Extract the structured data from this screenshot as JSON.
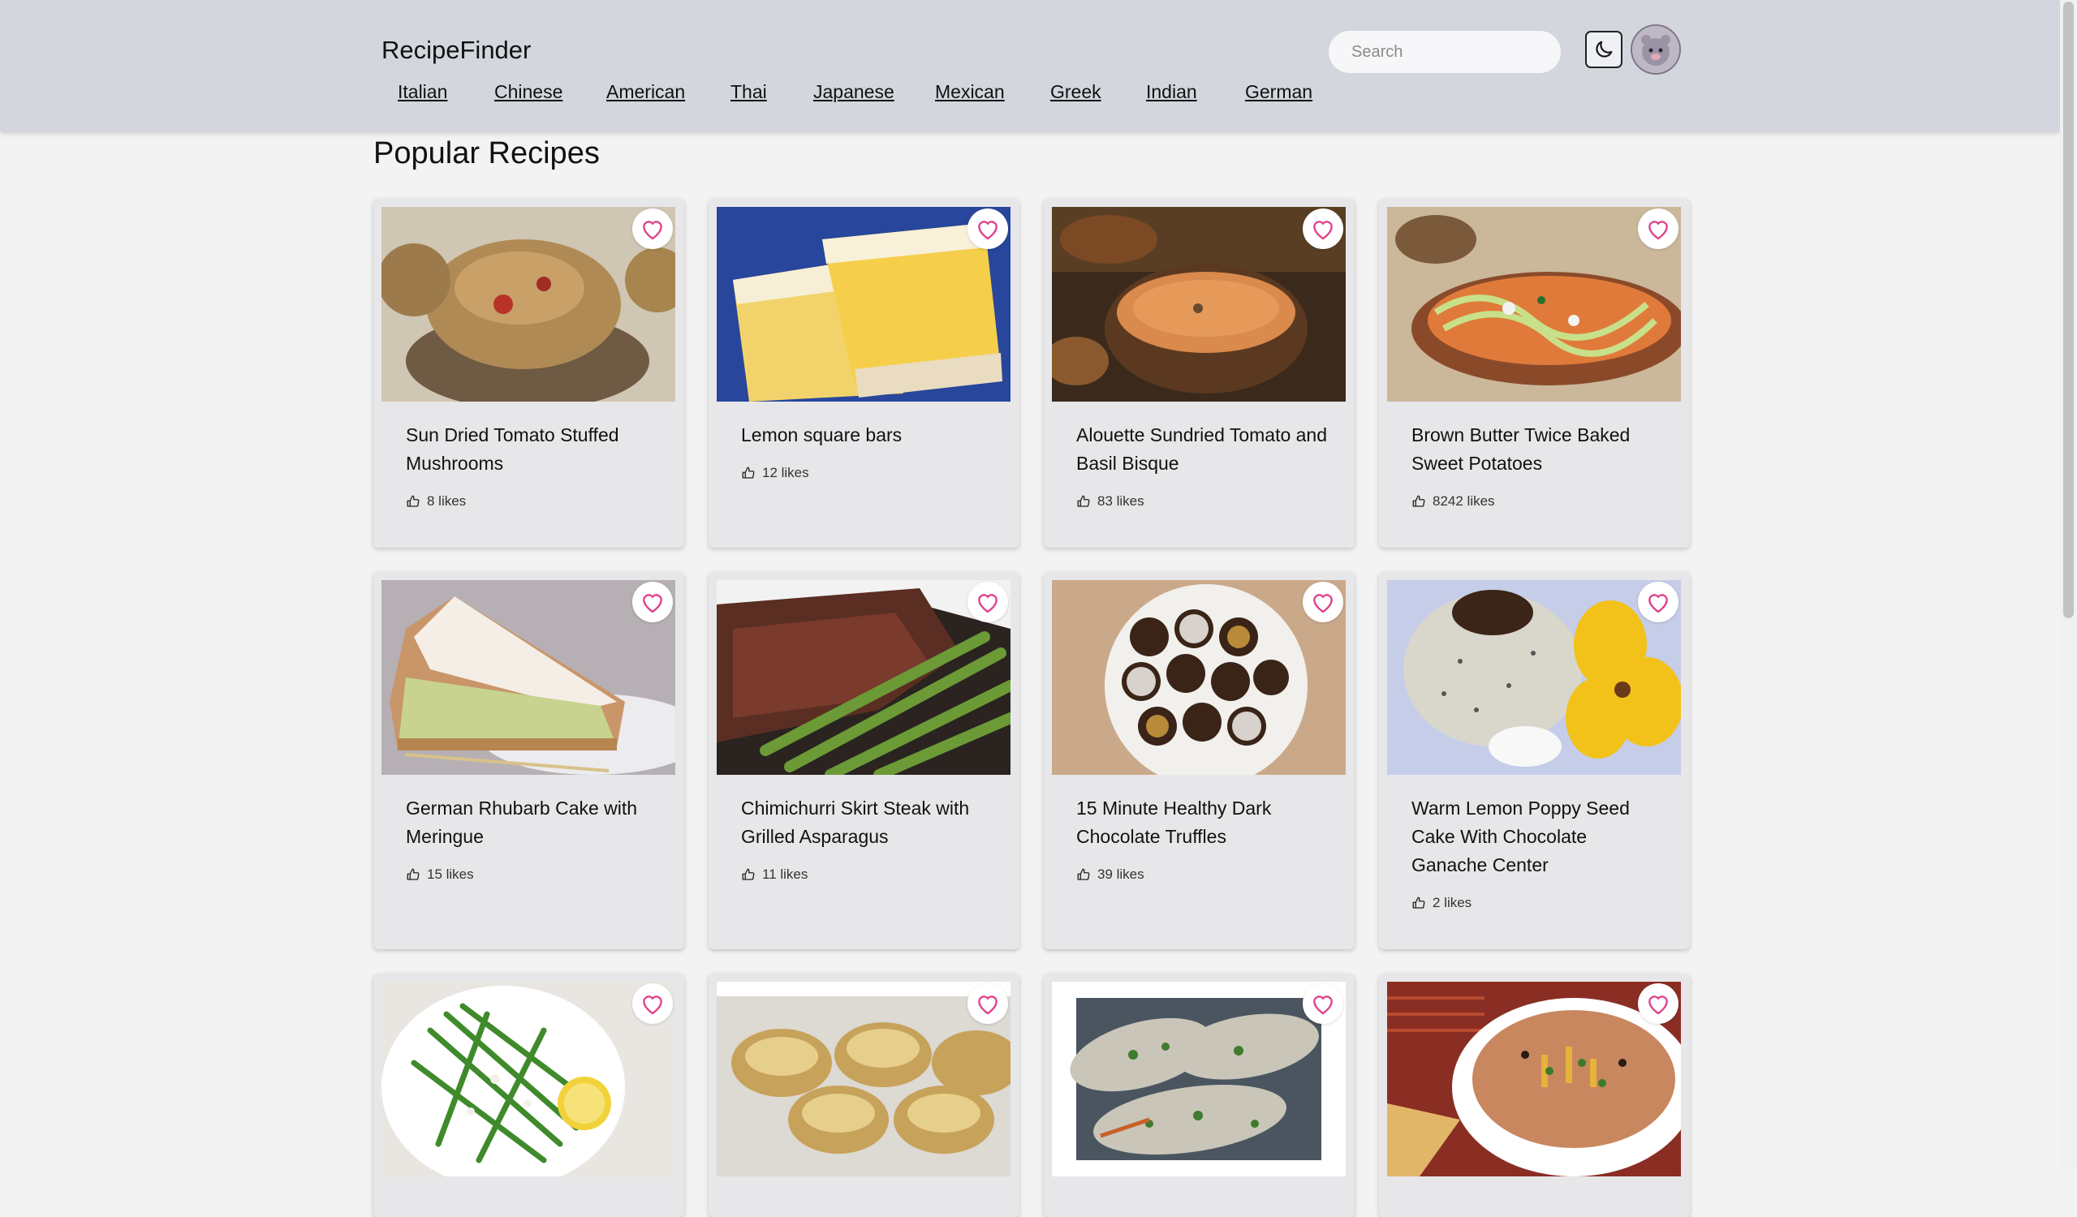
{
  "app": {
    "brand": "RecipeFinder"
  },
  "nav": [
    "Italian",
    "Chinese",
    "American",
    "Thai",
    "Japanese",
    "Mexican",
    "Greek",
    "Indian",
    "German"
  ],
  "search": {
    "placeholder": "Search",
    "value": ""
  },
  "icons": {
    "theme_toggle": "moon-icon",
    "favorite": "heart-icon",
    "likes": "thumbs-up-icon"
  },
  "colors": {
    "header_bg": "#d3d6dd",
    "page_bg": "#f3f3f3",
    "card_bg": "#e7e7ea",
    "heart": "#e0418a"
  },
  "main": {
    "section_title": "Popular Recipes",
    "recipes": [
      {
        "title": "Sun Dried Tomato Stuffed Mushrooms",
        "likes": "8 likes"
      },
      {
        "title": "Lemon square bars",
        "likes": "12 likes"
      },
      {
        "title": "Alouette Sundried Tomato and Basil Bisque",
        "likes": "83 likes"
      },
      {
        "title": "Brown Butter Twice Baked Sweet Potatoes",
        "likes": "8242 likes"
      },
      {
        "title": "German Rhubarb Cake with Meringue",
        "likes": "15 likes"
      },
      {
        "title": "Chimichurri Skirt Steak with Grilled Asparagus",
        "likes": "11 likes"
      },
      {
        "title": "15 Minute Healthy Dark Chocolate Truffles",
        "likes": "39 likes"
      },
      {
        "title": "Warm Lemon Poppy Seed Cake With Chocolate Ganache Center",
        "likes": "2 likes"
      },
      {
        "title": "",
        "likes": ""
      },
      {
        "title": "",
        "likes": ""
      },
      {
        "title": "",
        "likes": ""
      },
      {
        "title": "",
        "likes": ""
      }
    ]
  }
}
